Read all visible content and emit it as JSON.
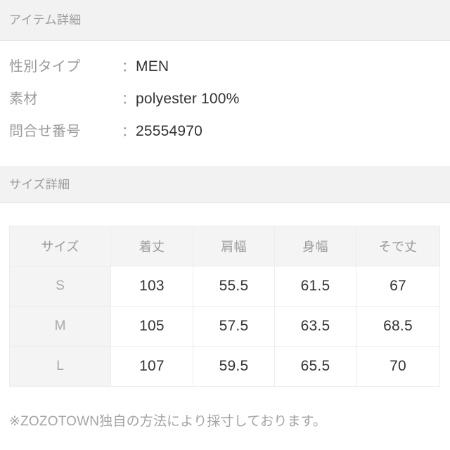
{
  "sections": {
    "item_detail": {
      "band_title": "アイテム詳細",
      "rows": [
        {
          "label": "性別タイプ",
          "separator": "：",
          "value": "MEN"
        },
        {
          "label": "素材",
          "separator": "：",
          "value": "polyester 100%"
        },
        {
          "label": "問合せ番号",
          "separator": "：",
          "value": "25554970"
        }
      ]
    },
    "size_detail": {
      "band_title": "サイズ詳細",
      "table": {
        "headers": [
          "サイズ",
          "着丈",
          "肩幅",
          "身幅",
          "そで丈"
        ],
        "rows": [
          {
            "size": "S",
            "values": [
              "103",
              "55.5",
              "61.5",
              "67"
            ]
          },
          {
            "size": "M",
            "values": [
              "105",
              "57.5",
              "63.5",
              "68.5"
            ]
          },
          {
            "size": "L",
            "values": [
              "107",
              "59.5",
              "65.5",
              "70"
            ]
          }
        ]
      },
      "footnote": "※ZOZOTOWN独自の方法により採寸しております。"
    }
  },
  "colors": {
    "band_background": "#f2f2f2",
    "table_header_background": "#f4f4f4",
    "label_text": "#9b9b9b",
    "value_text": "#333333",
    "border": "#ececec",
    "page_background": "#ffffff"
  }
}
